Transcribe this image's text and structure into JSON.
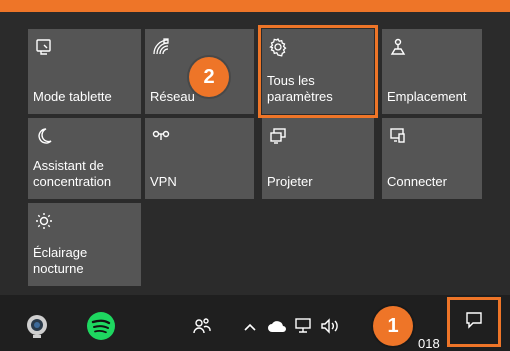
{
  "tiles": [
    {
      "label": "Mode tablette",
      "icon": "tablet-mode-icon"
    },
    {
      "label": "Réseau",
      "icon": "network-icon"
    },
    {
      "label": "Tous les\nparamètres",
      "icon": "settings-gear-icon"
    },
    {
      "label": "Emplacement",
      "icon": "location-icon"
    },
    {
      "label": "Assistant de\nconcentration",
      "icon": "focus-moon-icon"
    },
    {
      "label": "VPN",
      "icon": "vpn-icon"
    },
    {
      "label": "Projeter",
      "icon": "project-icon"
    },
    {
      "label": "Connecter",
      "icon": "connect-icon"
    },
    {
      "label": "Éclairage\nnocturne",
      "icon": "night-light-icon"
    }
  ],
  "badges": {
    "step1": "1",
    "step2": "2"
  },
  "taskbar": {
    "clock_fragment": "018",
    "icons": [
      "webcam-app-icon",
      "spotify-icon",
      "people-icon",
      "chevron-up-icon",
      "onedrive-icon",
      "network-status-icon",
      "volume-icon",
      "notification-icon"
    ]
  },
  "colors": {
    "accent": "#ee7528",
    "tile": "#555555",
    "background": "#2b2b2b",
    "taskbar": "#1f1f1f"
  }
}
